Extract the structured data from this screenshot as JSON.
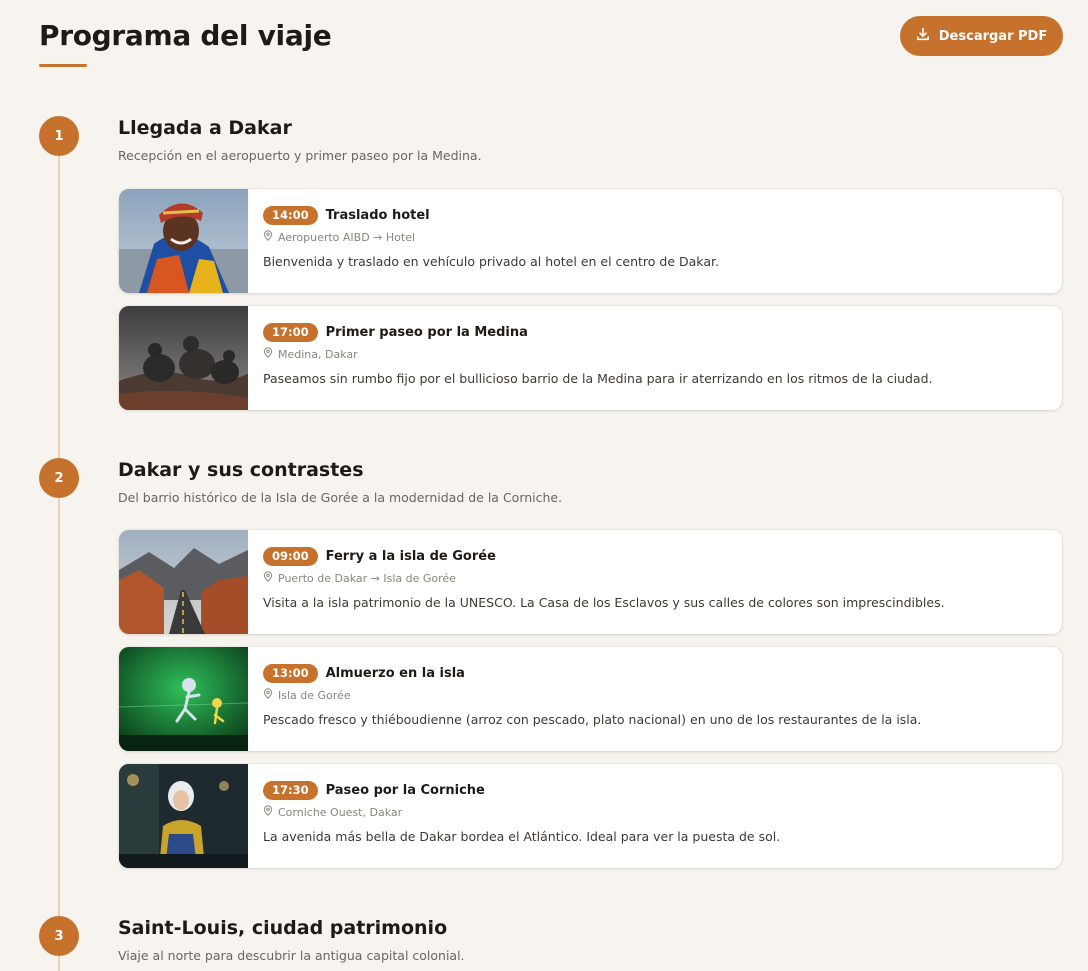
{
  "header": {
    "title": "Programa del viaje",
    "pdf_button": "Descargar PDF"
  },
  "days": [
    {
      "number": "1",
      "title": "Llegada a Dakar",
      "subtitle": "Recepción en el aeropuerto y primer paseo por la Medina.",
      "activities": [
        {
          "time": "14:00",
          "title": "Traslado hotel",
          "location": "Aeropuerto AIBD → Hotel",
          "description": "Bienvenida y traslado en vehículo privado al hotel en el centro de Dakar.",
          "image": "portrait-man-colorful-hat"
        },
        {
          "time": "17:00",
          "title": "Primer paseo por la Medina",
          "location": "Medina, Dakar",
          "description": "Paseamos sin rumbo fijo por el bullicioso barrio de la Medina para ir aterrizando en los ritmos de la ciudad.",
          "image": "pigeons-on-rock"
        }
      ]
    },
    {
      "number": "2",
      "title": "Dakar y sus contrastes",
      "subtitle": "Del barrio histórico de la Isla de Gorée a la modernidad de la Corniche.",
      "activities": [
        {
          "time": "09:00",
          "title": "Ferry a la isla de Gorée",
          "location": "Puerto de Dakar → Isla de Gorée",
          "description": "Visita a la isla patrimonio de la UNESCO. La Casa de los Esclavos y sus calles de colores son imprescindibles.",
          "image": "desert-road-canyon"
        },
        {
          "time": "13:00",
          "title": "Almuerzo en la isla",
          "location": "Isla de Gorée",
          "description": "Pescado fresco y thiéboudienne (arroz con pescado, plato nacional) en uno de los restaurantes de la isla.",
          "image": "green-screen-cartoon"
        },
        {
          "time": "17:30",
          "title": "Paseo por la Corniche",
          "location": "Corniche Ouest, Dakar",
          "description": "La avenida más bella de Dakar bordea el Atlántico. Ideal para ver la puesta de sol.",
          "image": "woman-in-cafe"
        }
      ]
    },
    {
      "number": "3",
      "title": "Saint-Louis, ciudad patrimonio",
      "subtitle": "Viaje al norte para descubrir la antigua capital colonial.",
      "activities": []
    }
  ],
  "colors": {
    "accent": "#c7722c",
    "background": "#f7f3ee",
    "timeline": "#efcfae"
  },
  "icons": {
    "download": "download-icon",
    "location": "location-pin-icon"
  }
}
